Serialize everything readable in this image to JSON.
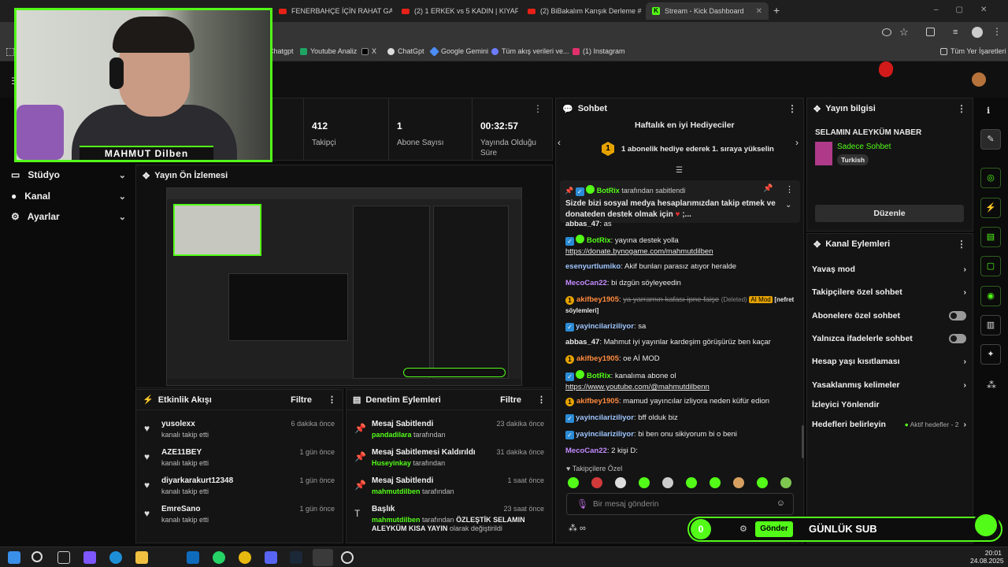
{
  "browser": {
    "tabs": [
      {
        "label": "FENERBAHÇE İÇİN RAHAT GALİ"
      },
      {
        "label": "(2) 1 ERKEK vs 5 KADIN | KIYAFE"
      },
      {
        "label": "(2) BiBakalım Karışık Derleme #"
      },
      {
        "label": "Stream - Kick Dashboard"
      }
    ],
    "new_tab": "+",
    "bookmarks": [
      "Chatgpt",
      "Youtube Analiz",
      "X",
      "ChatGpt",
      "Google Gemini",
      "Tüm akış verileri ve...",
      "(1) Instagram"
    ],
    "all_bookmarks": "Tüm Yer İşaretleri"
  },
  "webcam": {
    "overlay_name": "MAHMUT Dilben"
  },
  "stats": [
    {
      "value": "412",
      "label": "Takipçi"
    },
    {
      "value": "1",
      "label": "Abone Sayısı"
    },
    {
      "value": "00:32:57",
      "label": "Yayında Olduğu Süre"
    }
  ],
  "sidebar": {
    "items": [
      {
        "label": "Stüdyo"
      },
      {
        "label": "Kanal"
      },
      {
        "label": "Ayarlar"
      }
    ]
  },
  "preview": {
    "title": "Yayın Ön İzlemesi"
  },
  "activity": {
    "title": "Etkinlik Akışı",
    "filter": "Filtre",
    "items": [
      {
        "name": "yusolexx",
        "desc": "kanalı takip etti",
        "time": "6 dakika önce"
      },
      {
        "name": "AZE11BEY",
        "desc": "kanalı takip etti",
        "time": "1 gün önce"
      },
      {
        "name": "diyarkarakurt12348",
        "desc": "kanalı takip etti",
        "time": "1 gün önce"
      },
      {
        "name": "EmreSano",
        "desc": "kanalı takip etti",
        "time": "1 gün önce"
      }
    ]
  },
  "moderation": {
    "title": "Denetim Eylemleri",
    "filter": "Filtre",
    "items": [
      {
        "title": "Mesaj Sabitlendi",
        "user": "pandadilara",
        "suffix": "tarafından",
        "time": "23 dakika önce"
      },
      {
        "title": "Mesaj Sabitlemesi Kaldırıldı",
        "user": "Huseyinkay",
        "suffix": "tarafından",
        "time": "31 dakika önce"
      },
      {
        "title": "Mesaj Sabitlendi",
        "user": "mahmutdilben",
        "suffix": "tarafından",
        "time": "1 saat önce"
      },
      {
        "title": "Başlık",
        "user": "mahmutdilben",
        "suffix": "tarafından",
        "detail": "ÖZLEŞTİK SELAMIN ALEYKÜM KISA YAYIN",
        "detail_suffix": "olarak değiştirildi",
        "time": "23 saat önce"
      }
    ]
  },
  "chat": {
    "title": "Sohbet",
    "gifters_title": "Haftalık en iyi Hediyeciler",
    "gifters_text": "1 abonelik hediye ederek 1. sıraya yükselin",
    "gifters_rank": "1",
    "pinned": {
      "user": "BotRix",
      "label": "tarafından sabitlendi",
      "text": "Sizde bizi sosyal medya hesaplarımızdan takip etmek ve donateden destek olmak için",
      "tail": ";..."
    },
    "messages": [
      {
        "user": "abbas_47",
        "text": "as",
        "color": "#e8e8e8"
      },
      {
        "user": "BotRix",
        "text": "yayına destek yolla",
        "link": "https://donate.bynogame.com/mahmutdilben",
        "color": "#53fc18"
      },
      {
        "user": "esenyurtlumiko",
        "text": "Akif bunları parasız atıyor heralde",
        "color": "#9fc6ff"
      },
      {
        "user": "MecoCan22",
        "text": "bi dzgün söyleyeedin",
        "color": "#c38bff"
      },
      {
        "user": "akifbey1905",
        "text": "ya yarrarnın kafası ipne faişe",
        "deleted": "(Deleted)",
        "mod": "AI Mod",
        "reason": "[nefret söylemleri]",
        "color": "#ff8a3d"
      },
      {
        "user": "yayincilariziliyor",
        "text": "sa",
        "color": "#9fc6ff"
      },
      {
        "user": "abbas_47",
        "text": "Mahmut iyi yayınlar kardeşim görüşürüz ben kaçar",
        "color": "#e8e8e8"
      },
      {
        "user": "akifbey1905",
        "text": "oe Aİ MOD",
        "color": "#ff8a3d"
      },
      {
        "user": "BotRix",
        "text": "kanalıma abone ol",
        "link": "https://www.youtube.com/@mahmutdilbenn",
        "color": "#53fc18"
      },
      {
        "user": "akifbey1905",
        "text": "mamud yayıncılar izliyora neden küfür edion",
        "color": "#ff8a3d"
      },
      {
        "user": "yayincilariziliyor",
        "text": "bff olduk biz",
        "color": "#9fc6ff"
      },
      {
        "user": "yayincilariziliyor",
        "text": "bi ben onu sikiyorum bi o beni",
        "color": "#9fc6ff"
      },
      {
        "user": "MecoCan22",
        "text": "2 kişi D:",
        "color": "#c38bff"
      }
    ],
    "emote_label": "Takipçilere Özel",
    "input_placeholder": "Bir mesaj gönderin",
    "send_label": "Gönder",
    "points": "0"
  },
  "overlay": {
    "daily_sub": "GÜNLÜK SUB"
  },
  "stream_info": {
    "title": "Yayın bilgisi",
    "stream_title": "SELAMIN ALEYKÜM NABER",
    "category": "Sadece Sohbet",
    "language": "Turkish",
    "edit_label": "Düzenle"
  },
  "channel_actions": {
    "title": "Kanal Eylemleri",
    "items": [
      {
        "label": "Yavaş mod",
        "type": "chevron"
      },
      {
        "label": "Takipçilere özel sohbet",
        "type": "chevron"
      },
      {
        "label": "Abonelere özel sohbet",
        "type": "toggle"
      },
      {
        "label": "Yalnızca ifadelerle sohbet",
        "type": "toggle"
      },
      {
        "label": "Hesap yaşı kısıtlaması",
        "type": "chevron"
      },
      {
        "label": "Yasaklanmış kelimeler",
        "type": "chevron"
      },
      {
        "label": "İzleyici Yönlendir",
        "type": "none"
      },
      {
        "label": "Hedefleri belirleyin",
        "type": "chevron",
        "extra": "Aktif hedefler - 2"
      }
    ]
  },
  "taskbar": {
    "time": "20:01",
    "date": "24.08.2025"
  },
  "colors": {
    "accent": "#53fc18",
    "bg": "#0b0b0b",
    "panel": "#141414"
  }
}
